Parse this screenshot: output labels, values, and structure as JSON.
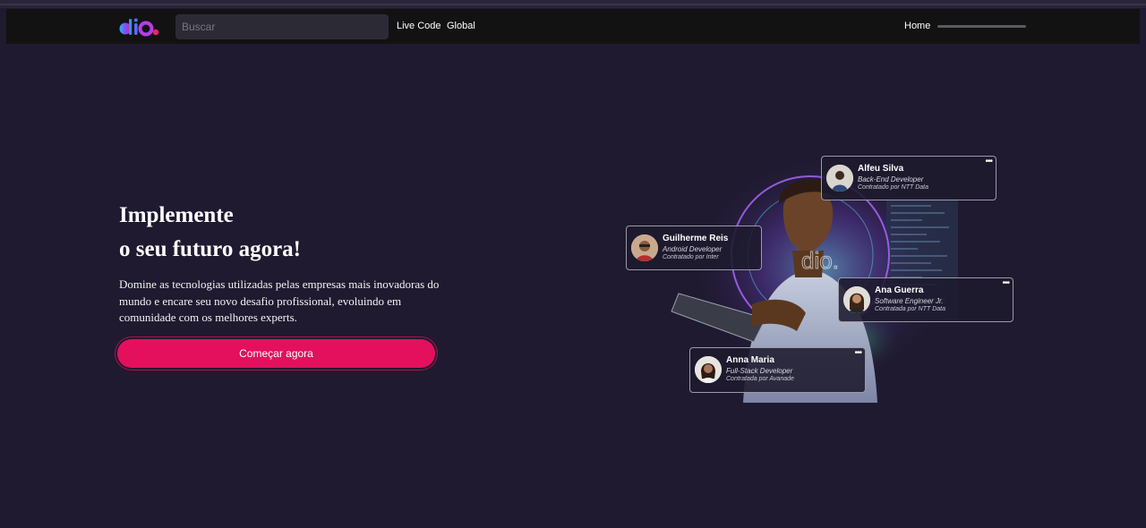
{
  "nav": {
    "logo": "dio",
    "search_placeholder": "Buscar",
    "links": [
      "Live Code",
      "Global"
    ],
    "home": "Home"
  },
  "hero": {
    "title_line1": "Implemente",
    "title_line2": "o seu futuro agora!",
    "description": "Domine as tecnologias utilizadas pelas empresas mais inovadoras do mundo e encare seu novo desafio profissional, evoluindo em comunidade com os melhores experts.",
    "cta": "Começar agora"
  },
  "cards": [
    {
      "name": "Alfeu Silva",
      "role": "Back-End Developer",
      "hired": "Contratado por NTT Data"
    },
    {
      "name": "Guilherme Reis",
      "role": "Android Developer",
      "hired": "Contratado por Inter"
    },
    {
      "name": "Ana Guerra",
      "role": "Software Engineer Jr.",
      "hired": "Contratada por NTT Data"
    },
    {
      "name": "Anna Maria",
      "role": "Full-Stack Developer",
      "hired": "Contratada por Avanade"
    }
  ],
  "card_menu_icon": "•••",
  "colors": {
    "background": "#1f1a30",
    "navbar": "#121212",
    "accent": "#e4105d"
  },
  "icons": [
    "dio-logo",
    "more-icon",
    "avatar"
  ]
}
